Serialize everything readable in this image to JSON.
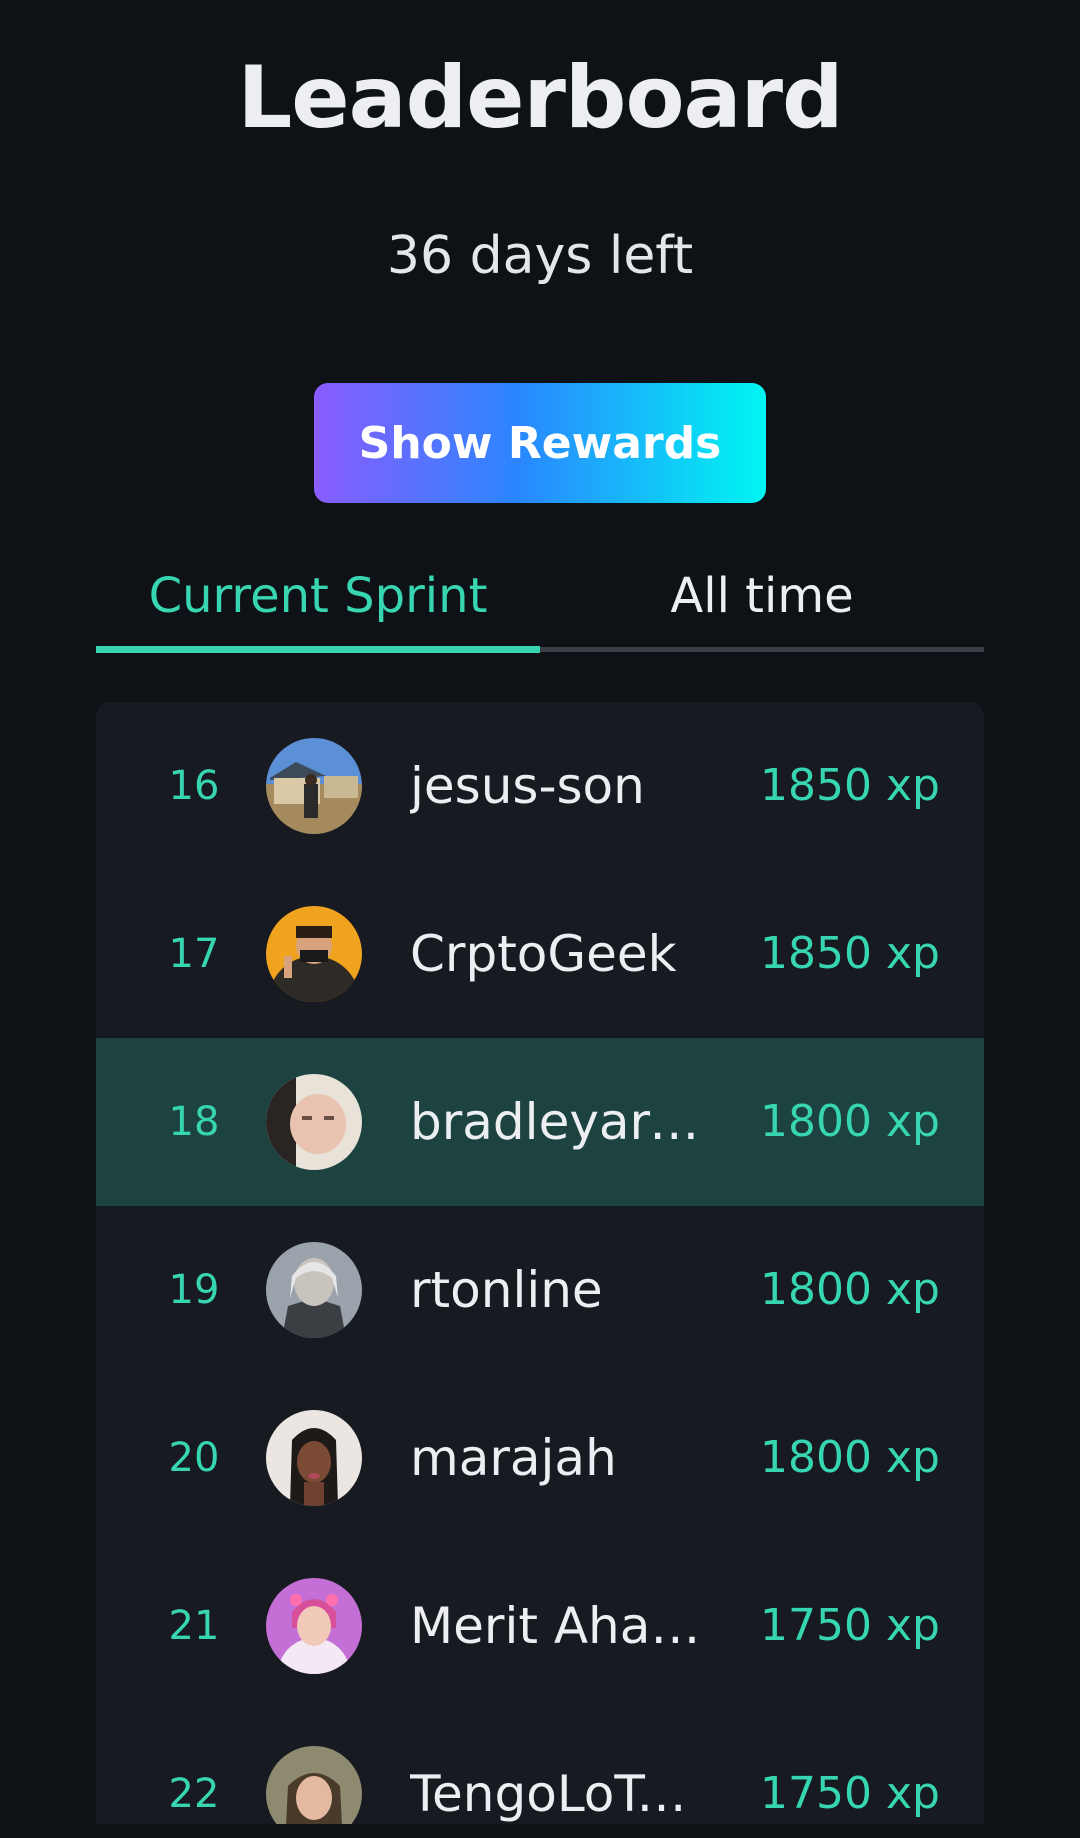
{
  "header": {
    "title": "Leaderboard",
    "countdown": "36 days left",
    "rewards_button": "Show Rewards"
  },
  "tabs": [
    {
      "label": "Current Sprint",
      "active": true
    },
    {
      "label": "All time",
      "active": false
    }
  ],
  "colors": {
    "background": "#0e1116",
    "card": "#171a20",
    "accent": "#37d6b0",
    "highlight_row": "#1d4340",
    "button_gradient": [
      "#8a5cff",
      "#2a86ff",
      "#00f6f2"
    ]
  },
  "leaderboard": [
    {
      "rank": "16",
      "name": "jesus-son",
      "xp": "1850 xp",
      "highlight": false
    },
    {
      "rank": "17",
      "name": "CrptoGeek",
      "xp": "1850 xp",
      "highlight": false
    },
    {
      "rank": "18",
      "name": "bradleyarr...",
      "xp": "1800 xp",
      "highlight": true
    },
    {
      "rank": "19",
      "name": "rtonline",
      "xp": "1800 xp",
      "highlight": false
    },
    {
      "rank": "20",
      "name": "marajah",
      "xp": "1800 xp",
      "highlight": false
    },
    {
      "rank": "21",
      "name": "Merit Aham...",
      "xp": "1750 xp",
      "highlight": false
    },
    {
      "rank": "22",
      "name": "TengoLoTo...",
      "xp": "1750 xp",
      "highlight": false
    }
  ]
}
